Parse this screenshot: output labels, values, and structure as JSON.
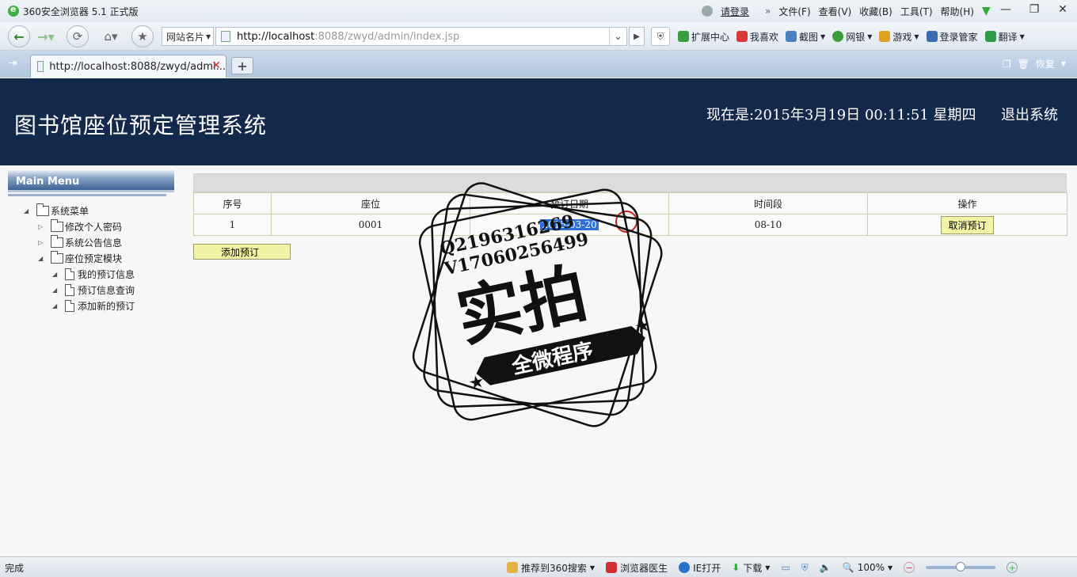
{
  "browser": {
    "title": "360安全浏览器 5.1 正式版",
    "login": "请登录",
    "menus": [
      "文件(F)",
      "查看(V)",
      "收藏(B)",
      "工具(T)",
      "帮助(H)"
    ],
    "sites_label": "网站名片",
    "url_host": "http://localhost",
    "url_rest": ":8088/zwyd/admin/index.jsp",
    "toolbar_items": [
      "扩展中心",
      "我喜欢",
      "截图",
      "网银",
      "游戏",
      "登录管家",
      "翻译"
    ],
    "tab_title": "http://localhost:8088/zwyd/admi...",
    "restore_label": "恢复",
    "status": "完成",
    "status_items": [
      "推荐到360搜索",
      "浏览器医生",
      "IE打开",
      "下载"
    ],
    "zoom": "100%"
  },
  "header": {
    "system_title": "图书馆座位预定管理系统",
    "clock": "现在是:2015年3月19日  00:11:51 星期四",
    "logout": "退出系统"
  },
  "sidebar": {
    "title": "Main Menu",
    "root": "系统菜单",
    "items": [
      {
        "label": "修改个人密码"
      },
      {
        "label": "系统公告信息"
      },
      {
        "label": "座位预定模块"
      }
    ],
    "sub_items": [
      {
        "label": "我的预订信息"
      },
      {
        "label": "预订信息查询"
      },
      {
        "label": "添加新的预订"
      }
    ]
  },
  "table": {
    "headers": [
      "序号",
      "座位",
      "预订日期",
      "时间段",
      "操作"
    ],
    "rows": [
      {
        "no": "1",
        "seat": "0001",
        "date": "2015-03-20",
        "slot": "08-10",
        "action": "取消预订"
      }
    ]
  },
  "add_button": "添加预订",
  "watermark": {
    "line1": "Q2196316269",
    "line2": "V17060256499",
    "main": "实拍",
    "ribbon": "全微程序"
  },
  "colors": {
    "header_bg": "#13294b",
    "button_bg": "#f3f3a6",
    "selection": "#2f6fd6"
  }
}
